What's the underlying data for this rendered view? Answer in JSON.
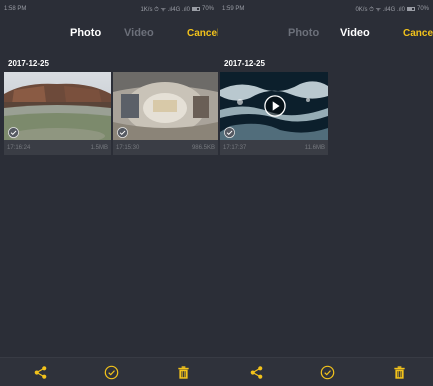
{
  "left_screen": {
    "statusbar": {
      "time": "1:58 PM",
      "right": "1K/s ⏱ ᯤ .ıl4G .ıl0",
      "battery_pct": "70%"
    },
    "tabs": {
      "photo": "Photo",
      "video": "Video",
      "cancel": "Cancel"
    },
    "date": "2017-12-25",
    "items": [
      {
        "time": "17:16:24",
        "size": "1.5MB"
      },
      {
        "time": "17:15:30",
        "size": "986.5KB"
      }
    ]
  },
  "right_screen": {
    "statusbar": {
      "time": "1:59 PM",
      "right": "0K/s ⏱ ᯤ .ıl4G .ıl0",
      "battery_pct": "70%"
    },
    "tabs": {
      "photo": "Photo",
      "video": "Video",
      "cancel": "Cancel"
    },
    "date": "2017-12-25",
    "items": [
      {
        "time": "17:17:37",
        "size": "11.6MB"
      }
    ]
  },
  "icons": {
    "share": "share-icon",
    "select": "check-circle-icon",
    "delete": "trash-icon",
    "play": "play-icon"
  },
  "colors": {
    "background": "#2b2e37",
    "accent": "#f3c31b",
    "tab_active": "#ffffff",
    "tab_inactive": "#6c707a"
  }
}
